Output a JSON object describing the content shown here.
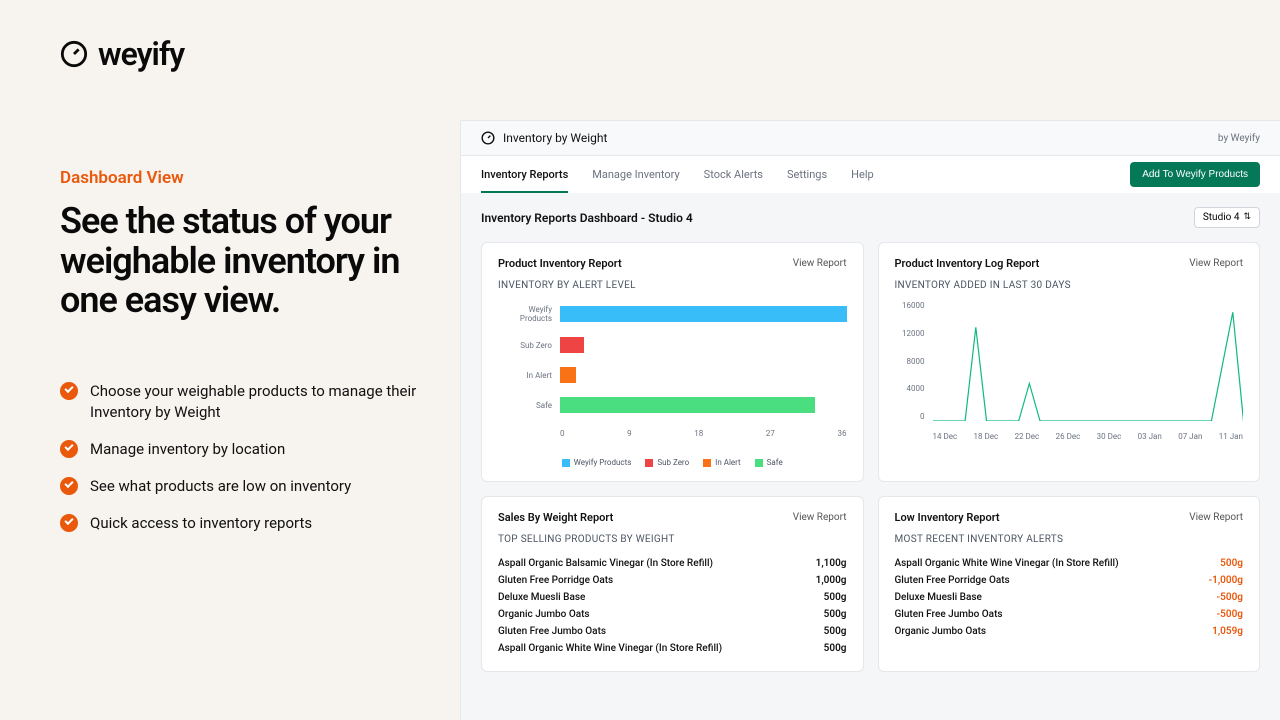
{
  "brand": {
    "name": "weyify"
  },
  "left": {
    "eyebrow": "Dashboard View",
    "headline": "See the status of your weighable inventory in one easy view.",
    "features": [
      "Choose your weighable products to manage their Inventory by Weight",
      "Manage inventory by location",
      "See what products are low on inventory",
      "Quick access to inventory reports"
    ]
  },
  "app": {
    "title": "Inventory by Weight",
    "byline": "by Weyify",
    "tabs": [
      "Inventory Reports",
      "Manage Inventory",
      "Stock Alerts",
      "Settings",
      "Help"
    ],
    "active_tab": 0,
    "cta": "Add To Weyify Products",
    "dash_title": "Inventory Reports Dashboard - Studio 4",
    "location_label": "Studio 4"
  },
  "cards": {
    "inventory_report": {
      "title": "Product Inventory Report",
      "view": "View Report",
      "subtitle": "INVENTORY BY ALERT LEVEL"
    },
    "log_report": {
      "title": "Product Inventory Log Report",
      "view": "View Report",
      "subtitle": "INVENTORY ADDED IN LAST 30 DAYS"
    },
    "sales": {
      "title": "Sales By Weight Report",
      "view": "View Report",
      "subtitle": "TOP SELLING PRODUCTS BY WEIGHT",
      "rows": [
        {
          "name": "Aspall Organic Balsamic Vinegar (In Store Refill)",
          "value": "1,100g"
        },
        {
          "name": "Gluten Free Porridge Oats",
          "value": "1,000g"
        },
        {
          "name": "Deluxe Muesli Base",
          "value": "500g"
        },
        {
          "name": "Organic Jumbo Oats",
          "value": "500g"
        },
        {
          "name": "Gluten Free Jumbo Oats",
          "value": "500g"
        },
        {
          "name": "Aspall Organic White Wine Vinegar (In Store Refill)",
          "value": "500g"
        }
      ]
    },
    "low": {
      "title": "Low Inventory Report",
      "view": "View Report",
      "subtitle": "MOST RECENT INVENTORY ALERTS",
      "rows": [
        {
          "name": "Aspall Organic White Wine Vinegar (In Store Refill)",
          "value": "500g",
          "neg": true
        },
        {
          "name": "Gluten Free Porridge Oats",
          "value": "-1,000g",
          "neg": true
        },
        {
          "name": "Deluxe Muesli Base",
          "value": "-500g",
          "neg": true
        },
        {
          "name": "Gluten Free Jumbo Oats",
          "value": "-500g",
          "neg": true
        },
        {
          "name": "Organic Jumbo Oats",
          "value": "1,059g",
          "neg": true
        }
      ]
    }
  },
  "chart_data": [
    {
      "type": "bar",
      "orientation": "horizontal",
      "title": "Inventory by Alert Level",
      "categories": [
        "Weyify Products",
        "Sub Zero",
        "In Alert",
        "Safe"
      ],
      "values": [
        36,
        3,
        2,
        32
      ],
      "colors": [
        "#38bdf8",
        "#ef4444",
        "#f97316",
        "#4ade80"
      ],
      "xlim": [
        0,
        36
      ],
      "x_ticks": [
        0,
        9,
        18,
        27,
        36
      ],
      "legend": [
        "Weyify Products",
        "Sub Zero",
        "In Alert",
        "Safe"
      ]
    },
    {
      "type": "line",
      "title": "Inventory Added in Last 30 Days",
      "x_ticks": [
        "14 Dec",
        "18 Dec",
        "22 Dec",
        "26 Dec",
        "30 Dec",
        "03 Jan",
        "07 Jan",
        "11 Jan"
      ],
      "y_ticks": [
        0,
        4000,
        8000,
        12000,
        16000
      ],
      "ylim": [
        0,
        16000
      ],
      "series": [
        {
          "name": "Inventory Added",
          "color": "#10b981",
          "points": [
            {
              "x": "14 Dec",
              "y": 0
            },
            {
              "x": "17 Dec",
              "y": 0
            },
            {
              "x": "18 Dec",
              "y": 12500
            },
            {
              "x": "19 Dec",
              "y": 0
            },
            {
              "x": "22 Dec",
              "y": 0
            },
            {
              "x": "23 Dec",
              "y": 5000
            },
            {
              "x": "24 Dec",
              "y": 0
            },
            {
              "x": "09 Jan",
              "y": 0
            },
            {
              "x": "11 Jan",
              "y": 14500
            },
            {
              "x": "12 Jan",
              "y": 0
            }
          ]
        }
      ]
    }
  ]
}
